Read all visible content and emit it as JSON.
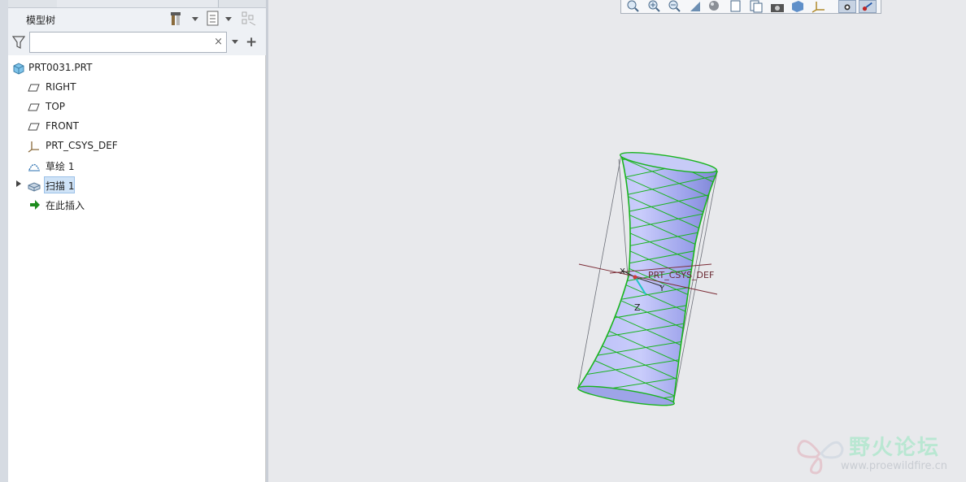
{
  "panel": {
    "title": "模型树",
    "search_placeholder": "",
    "search_clear": "×",
    "tree": [
      {
        "label": "PRT0031.PRT",
        "icon": "part-icon"
      },
      {
        "label": "RIGHT",
        "icon": "datum-plane-icon"
      },
      {
        "label": "TOP",
        "icon": "datum-plane-icon"
      },
      {
        "label": "FRONT",
        "icon": "datum-plane-icon"
      },
      {
        "label": "PRT_CSYS_DEF",
        "icon": "csys-icon"
      },
      {
        "label": "草绘 1",
        "icon": "sketch-icon"
      },
      {
        "label": "扫描 1",
        "icon": "sweep-icon",
        "selected": true,
        "expandable": true
      },
      {
        "label": "在此插入",
        "icon": "insert-here-arrow-icon"
      }
    ]
  },
  "graphics": {
    "csys_label": "PRT_CSYS_DEF",
    "axis_x": "X",
    "axis_y": "Y",
    "axis_z": "Z"
  },
  "watermark": {
    "title": "野火论坛",
    "url": "www.proewildfire.cn"
  },
  "colors": {
    "surface": "#a9aef0",
    "edge": "#18b41e",
    "selection": "#cfe3f7"
  }
}
